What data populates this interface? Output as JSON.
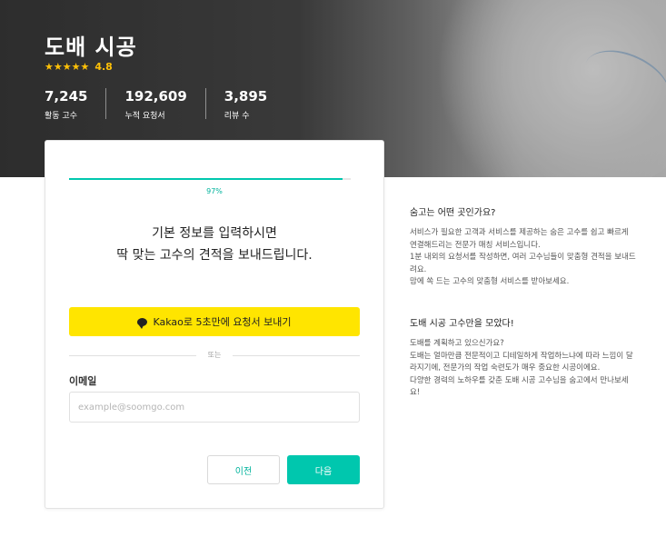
{
  "header": {
    "title": "도배 시공",
    "stars": "★★★★★",
    "rating": "4.8",
    "stats": [
      {
        "value": "7,245",
        "label": "활동 고수"
      },
      {
        "value": "192,609",
        "label": "누적 요청서"
      },
      {
        "value": "3,895",
        "label": "리뷰 수"
      }
    ]
  },
  "form": {
    "progress_percent": 97,
    "progress_label": "97%",
    "headline_line1": "기본 정보를 입력하시면",
    "headline_line2": "딱 맞는 고수의 견적을 보내드립니다.",
    "kakao_label": "Kakao로 5초만에 요청서 보내기",
    "divider_text": "또는",
    "email_label": "이메일",
    "email_placeholder": "example@soomgo.com",
    "email_value": "",
    "prev_label": "이전",
    "next_label": "다음"
  },
  "sidebar": {
    "section1": {
      "title": "숨고는 어떤 곳인가요?",
      "body": "서비스가 필요한 고객과 서비스를 제공하는 숨은 고수를 쉽고 빠르게 연결해드리는 전문가 매칭 서비스입니다.\n1분 내외의 요청서를 작성하면, 여러 고수님들이 맞춤형 견적을 보내드려요.\n맘에 쏙 드는 고수의 맞춤형 서비스를 받아보세요."
    },
    "section2": {
      "title": "도배 시공 고수만을 모았다!",
      "body": "도배를 계획하고 있으신가요?\n도배는 얼마만큼 전문적이고 디테일하게 작업하느냐에 따라 느낌이 달라지기에, 전문가의 작업 숙련도가 매우 중요한 시공이에요.\n다양한 경력의 노하우를 갖춘 도배 시공 고수님을 숨고에서 만나보세요!"
    }
  },
  "colors": {
    "accent": "#00c7ae",
    "kakao": "#ffe500",
    "star": "#ffc107"
  }
}
